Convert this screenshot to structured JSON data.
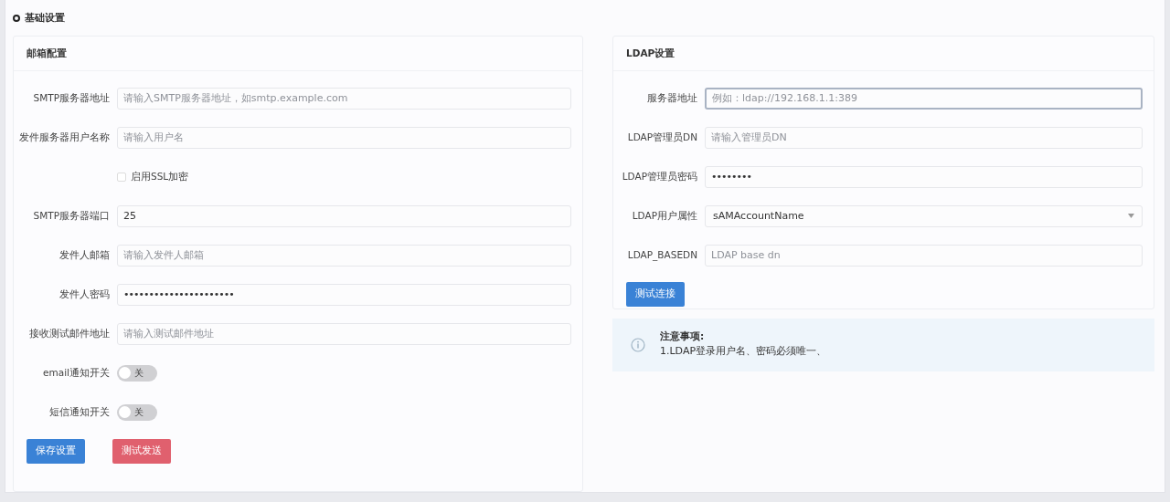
{
  "page_title": "基础设置",
  "mail_card": {
    "title": "邮箱配置",
    "fields": [
      {
        "kind": "text",
        "label": "SMTP服务器地址",
        "placeholder": "请输入SMTP服务器地址，如smtp.example.com"
      },
      {
        "kind": "text",
        "label": "发件服务器用户名称",
        "placeholder": "请输入用户名"
      },
      {
        "kind": "checkbox",
        "label": "启用SSL加密",
        "checked": false
      },
      {
        "kind": "text",
        "label": "SMTP服务器端口",
        "value": "25"
      },
      {
        "kind": "text",
        "label": "发件人邮箱",
        "placeholder": "请输入发件人邮箱"
      },
      {
        "kind": "password",
        "label": "发件人密码",
        "value": "••••••••••••••••••••••"
      },
      {
        "kind": "text",
        "label": "接收测试邮件地址",
        "placeholder": "请输入测试邮件地址"
      },
      {
        "kind": "switch",
        "label": "email通知开关",
        "on": false,
        "text": "关"
      },
      {
        "kind": "switch",
        "label": "短信通知开关",
        "on": false,
        "text": "关"
      }
    ],
    "buttons": [
      {
        "label": "保存设置",
        "kind": "submit"
      },
      {
        "label": "测试发送",
        "kind": "warning"
      }
    ]
  },
  "ldap_card": {
    "title": "LDAP设置",
    "fields": [
      {
        "kind": "text",
        "label": "服务器地址",
        "placeholder": "例如：ldap://192.168.1.1:389",
        "focused": true
      },
      {
        "kind": "text",
        "label": "LDAP管理员DN",
        "placeholder": "请输入管理员DN",
        "focused": false
      },
      {
        "kind": "password",
        "label": "LDAP管理员密码",
        "value": "••••••••",
        "focused": false
      },
      {
        "kind": "select",
        "label": "LDAP用户属性",
        "value": "sAMAccountName",
        "focused": false
      },
      {
        "kind": "text",
        "label": "LDAP_BASEDN",
        "placeholder": "LDAP base dn",
        "focused": false
      }
    ],
    "buttons": [
      {
        "label": "测试连接",
        "kind": "submit"
      }
    ]
  },
  "notice": {
    "title": "注意事项:",
    "text": "1.LDAP登录用户名、密码必须唯一、"
  }
}
